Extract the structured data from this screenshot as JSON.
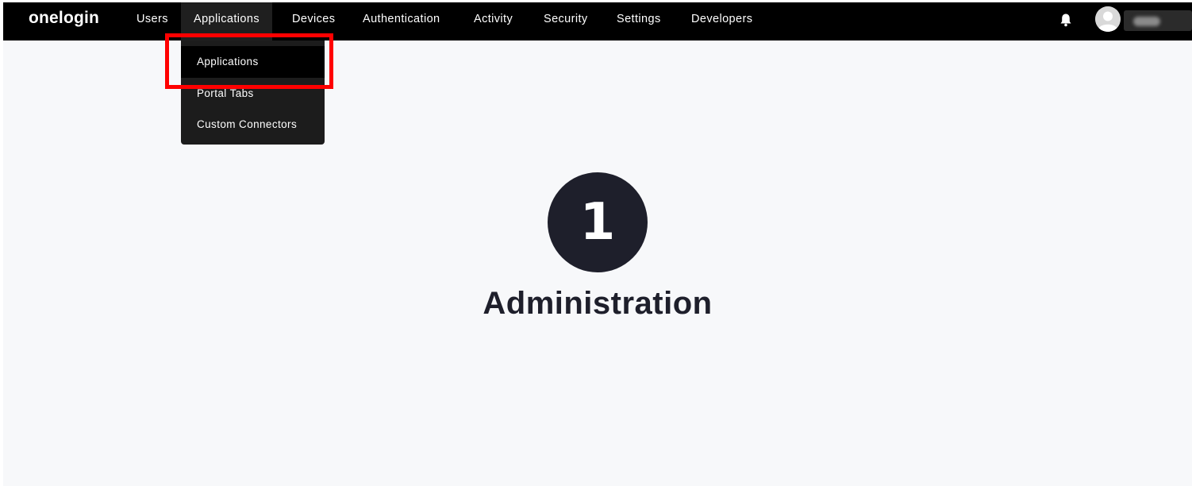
{
  "brand": {
    "logo_text": "onelogin"
  },
  "nav": {
    "items": [
      {
        "label": "Users"
      },
      {
        "label": "Applications"
      },
      {
        "label": "Devices"
      },
      {
        "label": "Authentication"
      },
      {
        "label": "Activity"
      },
      {
        "label": "Security"
      },
      {
        "label": "Settings"
      },
      {
        "label": "Developers"
      }
    ],
    "active": "Applications",
    "icons": {
      "notifications": "bell-icon",
      "user": "avatar-icon"
    }
  },
  "dropdown": {
    "items": [
      {
        "label": "Applications"
      },
      {
        "label": "Portal Tabs"
      },
      {
        "label": "Custom Connectors"
      }
    ],
    "highlighted": "Applications"
  },
  "main": {
    "badge_text": "1",
    "title": "Administration"
  },
  "colors": {
    "nav_background": "#000000",
    "page_background": "#f7f8fa",
    "highlight_border": "#ff0000",
    "badge_background": "#1e1f2b",
    "dropdown_background": "#1c1c1c"
  }
}
